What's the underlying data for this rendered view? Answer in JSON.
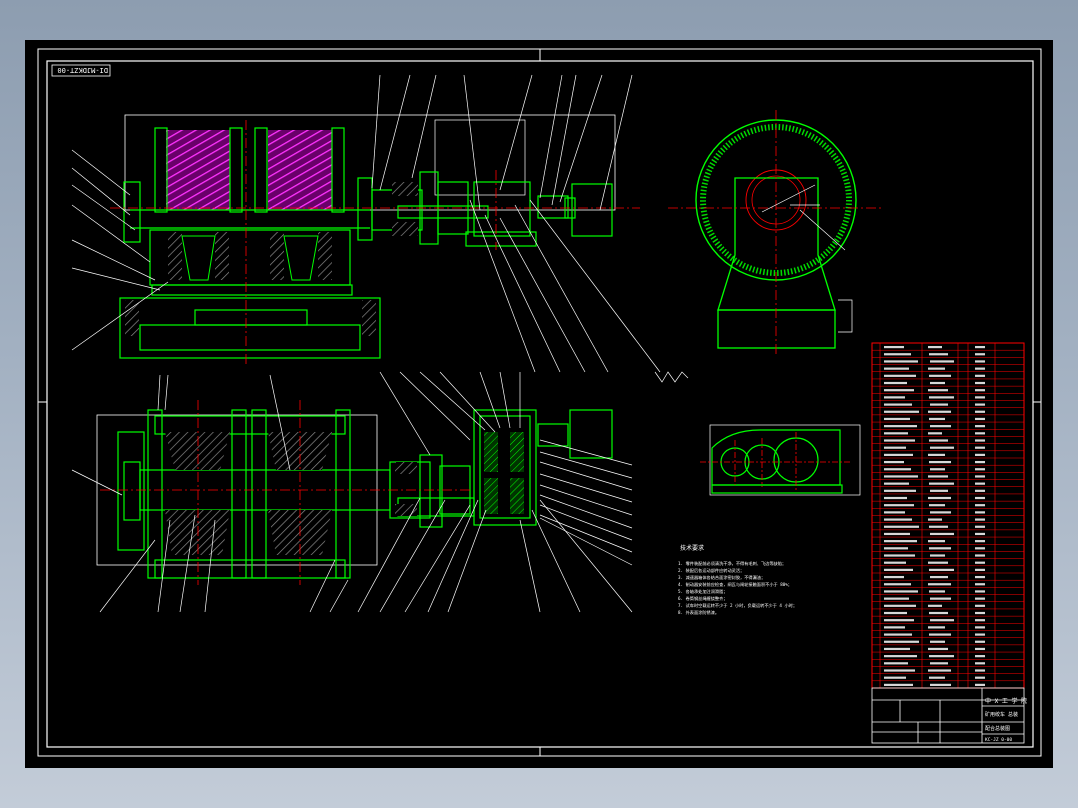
{
  "drawing": {
    "code_tag": "DI-MJDKZT-00",
    "school_block": "中 X 工 学 院",
    "title_line1": "矿用绞车 总装",
    "title_line2": "配合总装图",
    "drawing_number": "KC-JZ 0-00",
    "notes_title": "技术要求",
    "notes": [
      "1. 零件装配前必须清洗干净，不得有毛刺、飞边等缺陷；",
      "2. 装配后各运动部件应转动灵活；",
      "3. 减速器箱体各结合面涂密封胶，不得漏油；",
      "4. 制动器安装前应检查，闸瓦与闸轮接触面积不小于 80%；",
      "5. 各轴承处加注润滑脂；",
      "6. 卷筒钢丝绳缠绕整齐；",
      "7. 试车时空载运转不少于 2 小时，负载运转不少于 4 小时；",
      "8. 外表面涂防锈漆。"
    ]
  },
  "colors": {
    "cad_background": "#000000",
    "frame_line": "#ffffff",
    "outline": "#00ff00",
    "center_line": "#ff0000",
    "hatch": "#ff00ff",
    "bom_grid": "#ff0000",
    "window_gradient_top": "#8d9db0"
  }
}
